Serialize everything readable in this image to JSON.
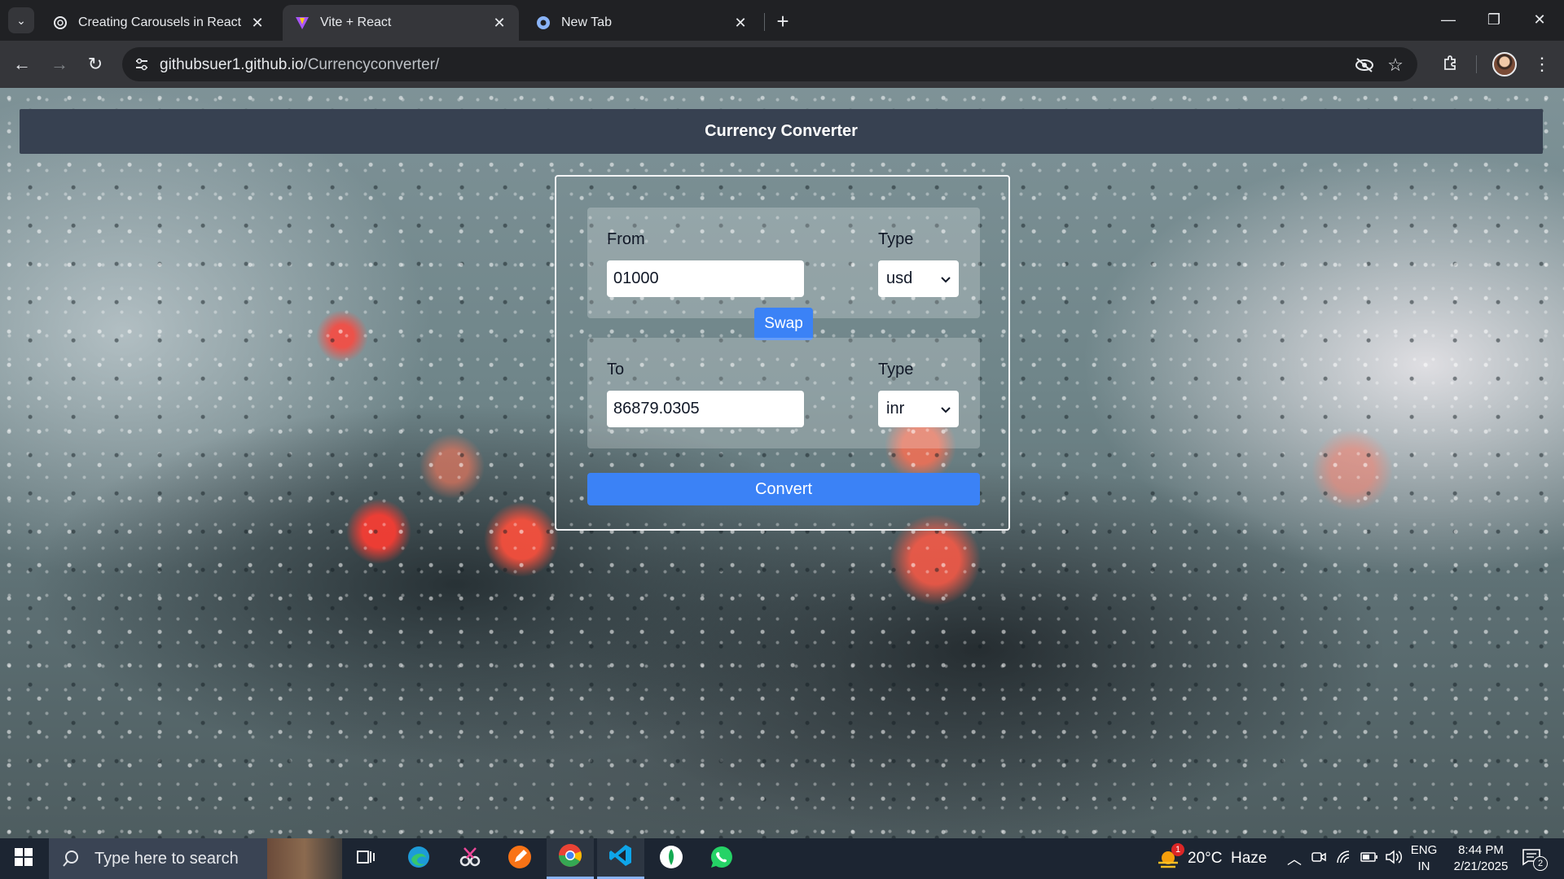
{
  "browser": {
    "tabs": [
      {
        "title": "Creating Carousels in React",
        "active": false,
        "favicon": "openai-icon"
      },
      {
        "title": "Vite + React",
        "active": true,
        "favicon": "vite-icon"
      },
      {
        "title": "New Tab",
        "active": false,
        "favicon": "chrome-newtab-icon"
      }
    ],
    "url_domain": "githubsuer1.github.io",
    "url_path": "/Currencyconverter/"
  },
  "app": {
    "title": "Currency Converter",
    "from": {
      "label": "From",
      "amount": "01000",
      "type_label": "Type",
      "currency": "usd"
    },
    "swap_label": "Swap",
    "to": {
      "label": "To",
      "amount": "86879.0305",
      "type_label": "Type",
      "currency": "inr"
    },
    "convert_label": "Convert",
    "accent_color": "#3b82f6",
    "header_color": "#374151"
  },
  "taskbar": {
    "search_placeholder": "Type here to search",
    "weather": "20°C  Haze",
    "weather_badge": "1",
    "language_top": "ENG",
    "language_bottom": "IN",
    "time": "8:44 PM",
    "date": "2/21/2025",
    "notification_count": "2"
  }
}
